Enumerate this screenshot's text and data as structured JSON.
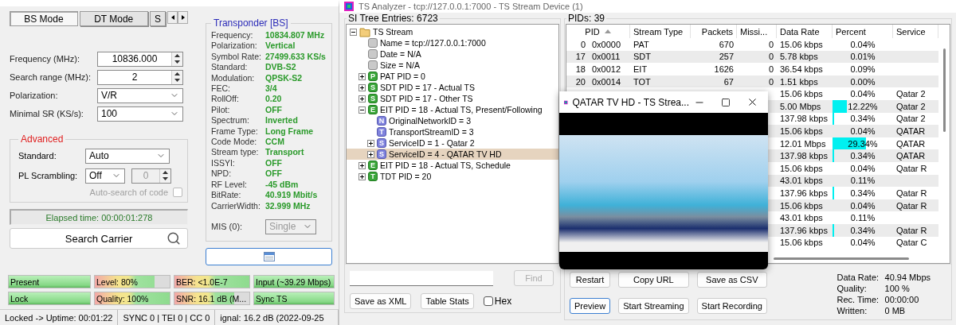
{
  "left_window": {
    "tabs": [
      {
        "label": "BS Mode",
        "selected": true
      },
      {
        "label": "DT Mode",
        "selected": false
      },
      {
        "label": "S",
        "selected": false
      }
    ],
    "form": [
      {
        "label": "Frequency (MHz):",
        "value": "10836.000",
        "kind": "spinner"
      },
      {
        "label": "Search range (MHz):",
        "value": "2",
        "kind": "spinner"
      },
      {
        "label": "Polarization:",
        "value": "V/R",
        "kind": "select"
      },
      {
        "label": "Minimal SR (KS/s):",
        "value": "100",
        "kind": "select"
      }
    ],
    "advanced": {
      "title": "Advanced",
      "standard_label": "Standard:",
      "standard_value": "Auto",
      "pl_label": "PL Scrambling:",
      "pl_value": "Off",
      "pl_code": "0",
      "pl_code_disabled": true,
      "auto_search": {
        "label": "Auto-search of code",
        "checked": false,
        "disabled": true
      }
    },
    "elapsed": "Elapsed time: 00:00:01:278",
    "search_button": "Search Carrier",
    "transponder": {
      "title": "Transponder [BS]",
      "fields": [
        {
          "label": "Frequency:",
          "value": "10834.807 MHz"
        },
        {
          "label": "Polarization:",
          "value": "Vertical"
        },
        {
          "label": "Symbol Rate:",
          "value": "27499.633 KS/s"
        },
        {
          "label": "Standard:",
          "value": "DVB-S2"
        },
        {
          "label": "Modulation:",
          "value": "QPSK-S2"
        },
        {
          "label": "FEC:",
          "value": "3/4"
        },
        {
          "label": "RollOff:",
          "value": "0.20"
        },
        {
          "label": "Pilot:",
          "value": "OFF"
        },
        {
          "label": "Spectrum:",
          "value": "Inverted"
        },
        {
          "label": "Frame Type:",
          "value": "Long Frame"
        },
        {
          "label": "Code Mode:",
          "value": "CCM"
        },
        {
          "label": "Stream type:",
          "value": "Transport"
        },
        {
          "label": "ISSYI:",
          "value": "OFF"
        },
        {
          "label": "NPD:",
          "value": "OFF"
        },
        {
          "label": "RF Level:",
          "value": "-45 dBm"
        },
        {
          "label": "BitRate:",
          "value": "40.919 Mbit/s"
        },
        {
          "label": "CarrierWidth:",
          "value": "32.999 MHz"
        }
      ],
      "mis": {
        "label": "MIS (0):",
        "value": "Single",
        "disabled": true
      }
    },
    "indicators": [
      {
        "label": "Present",
        "kind": "solid",
        "level": 1
      },
      {
        "label": "Level: 80%",
        "kind": "gauge",
        "level": 0.8
      },
      {
        "label": "BER: <1.0E-7",
        "kind": "gauge",
        "level": 1
      },
      {
        "label": "Input (~39.29 Mbps)",
        "kind": "solid",
        "level": 1
      },
      {
        "label": "Lock",
        "kind": "solid",
        "level": 1
      },
      {
        "label": "Quality: 100%",
        "kind": "gauge",
        "level": 1
      },
      {
        "label": "SNR: 16.1 dB (M...",
        "kind": "gauge",
        "level": 0.8
      },
      {
        "label": "Sync TS",
        "kind": "solid",
        "level": 1
      }
    ],
    "status_bar": [
      "Locked -> Uptime: 00:01:22",
      "SYNC 0 | TEI 0 | CC 0",
      "ignal: 16.2 dB (2022-09-25"
    ]
  },
  "analyzer": {
    "title": "TS Analyzer - tcp://127.0.0.1:7000 - TS Stream Device (1)",
    "tree": {
      "title": "SI Tree Entries: 6723",
      "items": [
        {
          "label": "TS Stream",
          "kind": "folder",
          "expanded": true,
          "selected": false,
          "children": [
            {
              "label": "Name = tcp://127.0.0.1:7000",
              "kind": "info",
              "selected": false
            },
            {
              "label": "Date = N/A",
              "kind": "info",
              "selected": false
            },
            {
              "label": "Size = N/A",
              "kind": "info",
              "selected": false
            },
            {
              "label": "PAT PID = 0",
              "kind": "table",
              "badge": "P",
              "expanded": false,
              "selected": false
            },
            {
              "label": "SDT PID = 17 - Actual TS",
              "kind": "table",
              "badge": "S",
              "expanded": false,
              "selected": false
            },
            {
              "label": "SDT PID = 17 - Other TS",
              "kind": "table",
              "badge": "S",
              "expanded": false,
              "selected": false
            },
            {
              "label": "EIT PID = 18 - Actual TS, Present/Following",
              "kind": "table",
              "badge": "E",
              "expanded": true,
              "selected": false,
              "children": [
                {
                  "label": "OriginalNetworkID = 3",
                  "kind": "descriptor",
                  "badge": "N",
                  "selected": false
                },
                {
                  "label": "TransportStreamID = 3",
                  "kind": "descriptor",
                  "badge": "T",
                  "selected": false
                },
                {
                  "label": "ServiceID = 1 - Qatar 2",
                  "kind": "descriptor",
                  "badge": "S",
                  "expanded": false,
                  "selected": false
                },
                {
                  "label": "ServiceID = 4 - QATAR TV HD",
                  "kind": "descriptor",
                  "badge": "S",
                  "expanded": false,
                  "selected": true
                }
              ]
            },
            {
              "label": "EIT PID = 18 - Actual TS, Schedule",
              "kind": "table",
              "badge": "E",
              "expanded": false,
              "selected": false
            },
            {
              "label": "TDT PID = 20",
              "kind": "table",
              "badge": "T",
              "expanded": false,
              "selected": false
            }
          ]
        }
      ]
    },
    "find": {
      "button": "Find",
      "disabled": true
    },
    "tree_buttons": [
      "Save as XML",
      "Table Stats"
    ],
    "hex": {
      "label": "Hex",
      "checked": false
    },
    "pids": {
      "title": "PIDs: 39",
      "columns": [
        {
          "label": "PID",
          "sorted": true
        },
        {
          "label": "Stream Type",
          "sorted": false
        },
        {
          "label": "Packets",
          "sorted": false
        },
        {
          "label": "Missi...",
          "sorted": false
        },
        {
          "label": "Data Rate",
          "sorted": false
        },
        {
          "label": "Percent",
          "sorted": false
        },
        {
          "label": "Service",
          "sorted": false
        }
      ],
      "rows": [
        {
          "pid": "0",
          "hex": "0x0000",
          "type": "PAT",
          "packets": "670",
          "missing": "0",
          "rate": "15.06 kbps",
          "percent": "0.04%"
        },
        {
          "pid": "17",
          "hex": "0x0011",
          "type": "SDT",
          "packets": "257",
          "missing": "0",
          "rate": "5.78 kbps",
          "percent": "0.01%"
        },
        {
          "pid": "18",
          "hex": "0x0012",
          "type": "EIT",
          "packets": "1626",
          "missing": "0",
          "rate": "36.54 kbps",
          "percent": "0.09%"
        },
        {
          "pid": "20",
          "hex": "0x0014",
          "type": "TOT",
          "packets": "67",
          "missing": "0",
          "rate": "1.51 kbps",
          "percent": "0.00%"
        },
        {
          "rate": "15.06 kbps",
          "percent": "0.04%",
          "service": "Qatar 2"
        },
        {
          "rate": "5.00 Mbps",
          "percent": "12.22%",
          "service": "Qatar 2"
        },
        {
          "rate": "137.98 kbps",
          "percent": "0.34%",
          "service": "Qatar 2"
        },
        {
          "rate": "15.06 kbps",
          "percent": "0.04%",
          "service": "QATAR"
        },
        {
          "rate": "12.01 Mbps",
          "percent": "29.34%",
          "service": "QATAR"
        },
        {
          "rate": "137.98 kbps",
          "percent": "0.34%",
          "service": "QATAR"
        },
        {
          "rate": "15.06 kbps",
          "percent": "0.04%",
          "service": "Qatar R"
        },
        {
          "rate": "43.01 kbps",
          "percent": "0.11%"
        },
        {
          "rate": "137.96 kbps",
          "percent": "0.34%",
          "service": "Qatar R"
        },
        {
          "rate": "15.06 kbps",
          "percent": "0.04%",
          "service": "Qatar R"
        },
        {
          "rate": "43.01 kbps",
          "percent": "0.11%"
        },
        {
          "rate": "137.96 kbps",
          "percent": "0.34%",
          "service": "Qatar R"
        },
        {
          "rate": "15.06 kbps",
          "percent": "0.04%",
          "service": "Qatar C"
        }
      ]
    },
    "buttons": [
      {
        "label": "Restart",
        "focused": false
      },
      {
        "label": "Copy URL",
        "focused": false
      },
      {
        "label": "Save as CSV",
        "focused": false
      },
      {
        "label": "Preview",
        "focused": true
      },
      {
        "label": "Start Streaming",
        "focused": false
      },
      {
        "label": "Start Recording",
        "focused": false
      }
    ],
    "stats": [
      {
        "label": "Data Rate:",
        "value": "40.94 Mbps"
      },
      {
        "label": "Quality:",
        "value": "100 %"
      },
      {
        "label": "Rec. Time:",
        "value": "00:00:00"
      },
      {
        "label": "Written:",
        "value": "0 MB"
      }
    ],
    "preview_window": {
      "title": "QATAR TV HD - TS Strea..."
    }
  }
}
